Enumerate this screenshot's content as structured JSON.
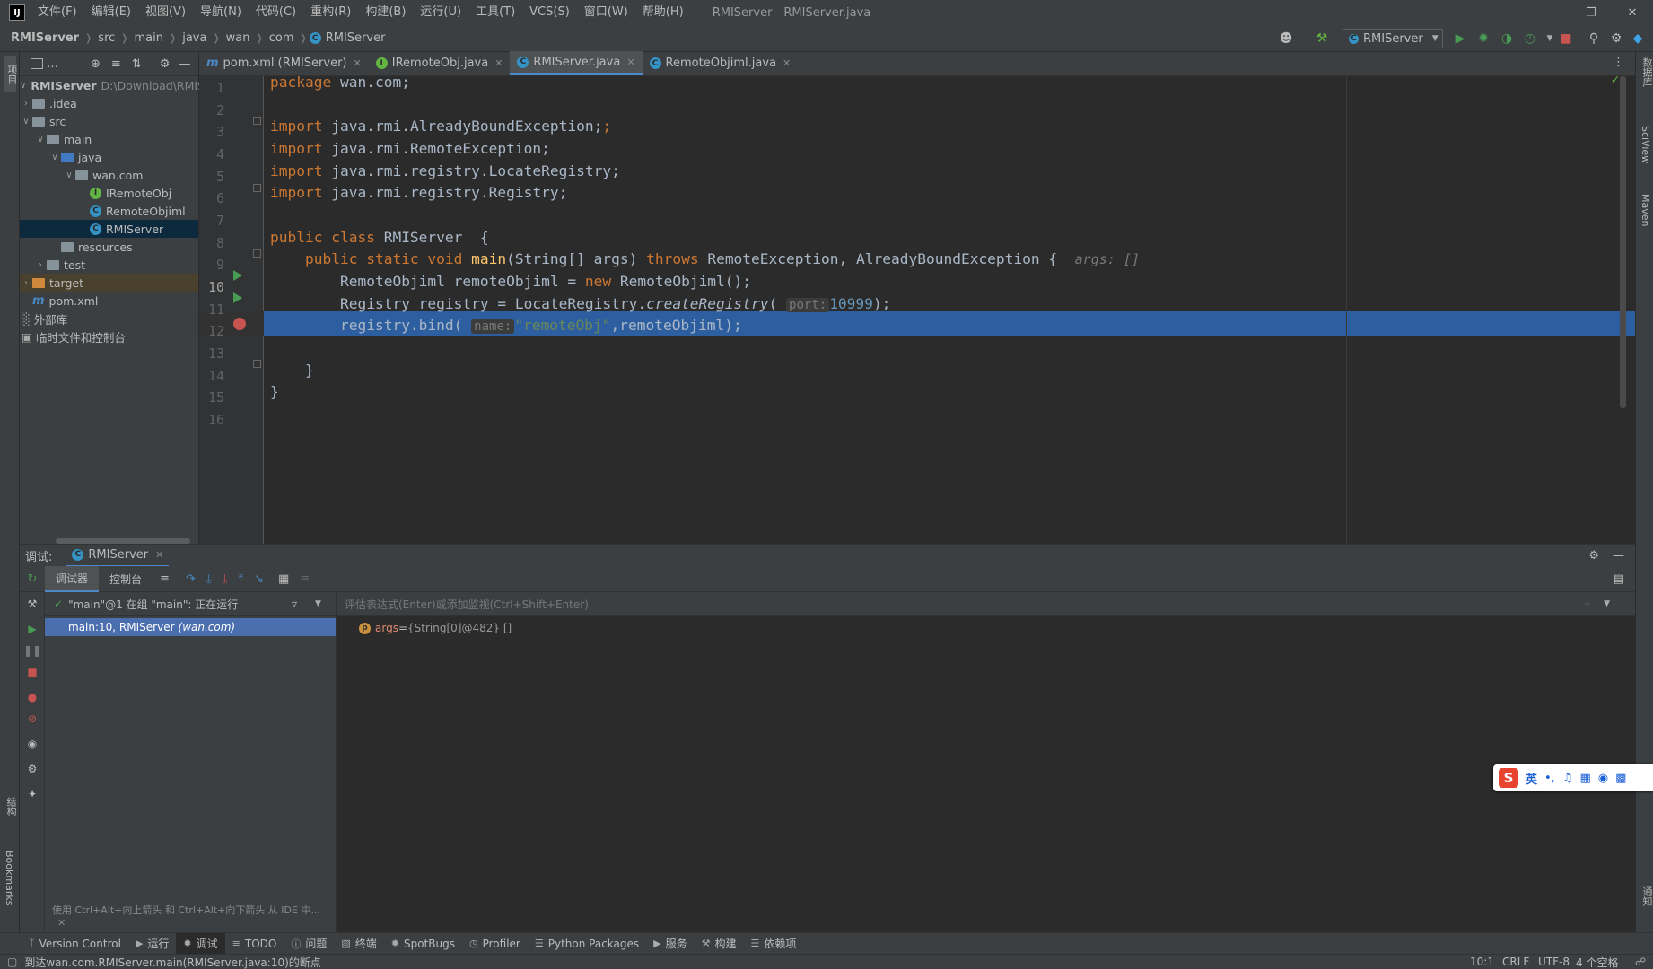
{
  "window": {
    "title": "RMIServer - RMIServer.java",
    "menus": [
      "文件(F)",
      "编辑(E)",
      "视图(V)",
      "导航(N)",
      "代码(C)",
      "重构(R)",
      "构建(B)",
      "运行(U)",
      "工具(T)",
      "VCS(S)",
      "窗口(W)",
      "帮助(H)"
    ]
  },
  "breadcrumb": [
    "RMIServer",
    "src",
    "main",
    "java",
    "wan",
    "com",
    "RMIServer"
  ],
  "toolbar": {
    "run_config": "RMIServer"
  },
  "project": {
    "root_name": "RMIServer",
    "root_path": "D:\\Download\\RMIS",
    "items": [
      {
        "label": ".idea"
      },
      {
        "label": "src"
      },
      {
        "label": "main"
      },
      {
        "label": "java"
      },
      {
        "label": "wan.com"
      },
      {
        "label": "IRemoteObj"
      },
      {
        "label": "RemoteObjiml"
      },
      {
        "label": "RMIServer"
      },
      {
        "label": "resources"
      },
      {
        "label": "test"
      },
      {
        "label": "target"
      },
      {
        "label": "pom.xml"
      },
      {
        "label": "外部库"
      },
      {
        "label": "临时文件和控制台"
      }
    ]
  },
  "tabs": [
    {
      "label": "pom.xml (RMIServer)"
    },
    {
      "label": "IRemoteObj.java"
    },
    {
      "label": "RMIServer.java"
    },
    {
      "label": "RemoteObjiml.java"
    }
  ],
  "editor": {
    "line_numbers": [
      "1",
      "2",
      "3",
      "4",
      "5",
      "6",
      "7",
      "8",
      "9",
      "10",
      "11",
      "12",
      "13",
      "14",
      "15",
      "16"
    ],
    "code": {
      "l1_kw": "package",
      "l1_rest": " wan.com;",
      "imp_kw": "import",
      "l3": " java.rmi.AlreadyBoundException;",
      "l4": " java.rmi.RemoteException;",
      "l5": " java.rmi.registry.LocateRegistry;",
      "l6": " java.rmi.registry.Registry;",
      "l8_kw": "public class",
      "l8_rest": " RMIServer  {",
      "l9_kw": "public static void",
      "l9_fn": "main",
      "l9_mid": "(String[] args) ",
      "l9_throws": "throws",
      "l9_rest": " RemoteException, AlreadyBoundException {",
      "l9_val": "args: []",
      "l10_a": "RemoteObjiml remoteObjiml = ",
      "l10_new": "new",
      "l10_b": " RemoteObjiml();",
      "l11_a": "Registry registry = LocateRegistry.",
      "l11_fn": "createRegistry",
      "l11_hint": "port:",
      "l11_num": "10999",
      "l11_b": ");",
      "l12_a": "registry.bind(",
      "l12_hint": "name:",
      "l12_str": "\"remoteObj\"",
      "l12_b": ",remoteObjiml);",
      "l14": "}",
      "l15": "}"
    }
  },
  "debug": {
    "header_label": "调试:",
    "session_tab": "RMIServer",
    "subtabs": [
      "调试器",
      "控制台"
    ],
    "thread": "\"main\"@1 在组 \"main\": 正在运行",
    "frame_main": "main:10, RMIServer",
    "frame_pkg": "(wan.com)",
    "frames_hint": "使用 Ctrl+Alt+向上箭头 和 Ctrl+Alt+向下箭头 从 IDE 中...",
    "eval_placeholder": "评估表达式(Enter)或添加监视(Ctrl+Shift+Enter)",
    "var_name": "args",
    "var_eq": " = ",
    "var_value": "{String[0]@482} []"
  },
  "ime": {
    "lang": "英",
    "punct": "•,"
  },
  "bottom_tabs": [
    "Version Control",
    "运行",
    "调试",
    "TODO",
    "问题",
    "终端",
    "SpotBugs",
    "Profiler",
    "Python Packages",
    "服务",
    "构建",
    "依赖项"
  ],
  "left_stripe": {
    "project": "项目",
    "structure": "结构",
    "bookmarks": "Bookmarks"
  },
  "right_stripe": {
    "db": "数据库",
    "sciview": "SciView",
    "maven": "Maven",
    "notify": "通知"
  },
  "status": {
    "message": "到达wan.com.RMIServer.main(RMIServer.java:10)的断点",
    "position": "10:1",
    "line_sep": "CRLF",
    "encoding": "UTF-8",
    "indent": "4 个空格"
  }
}
